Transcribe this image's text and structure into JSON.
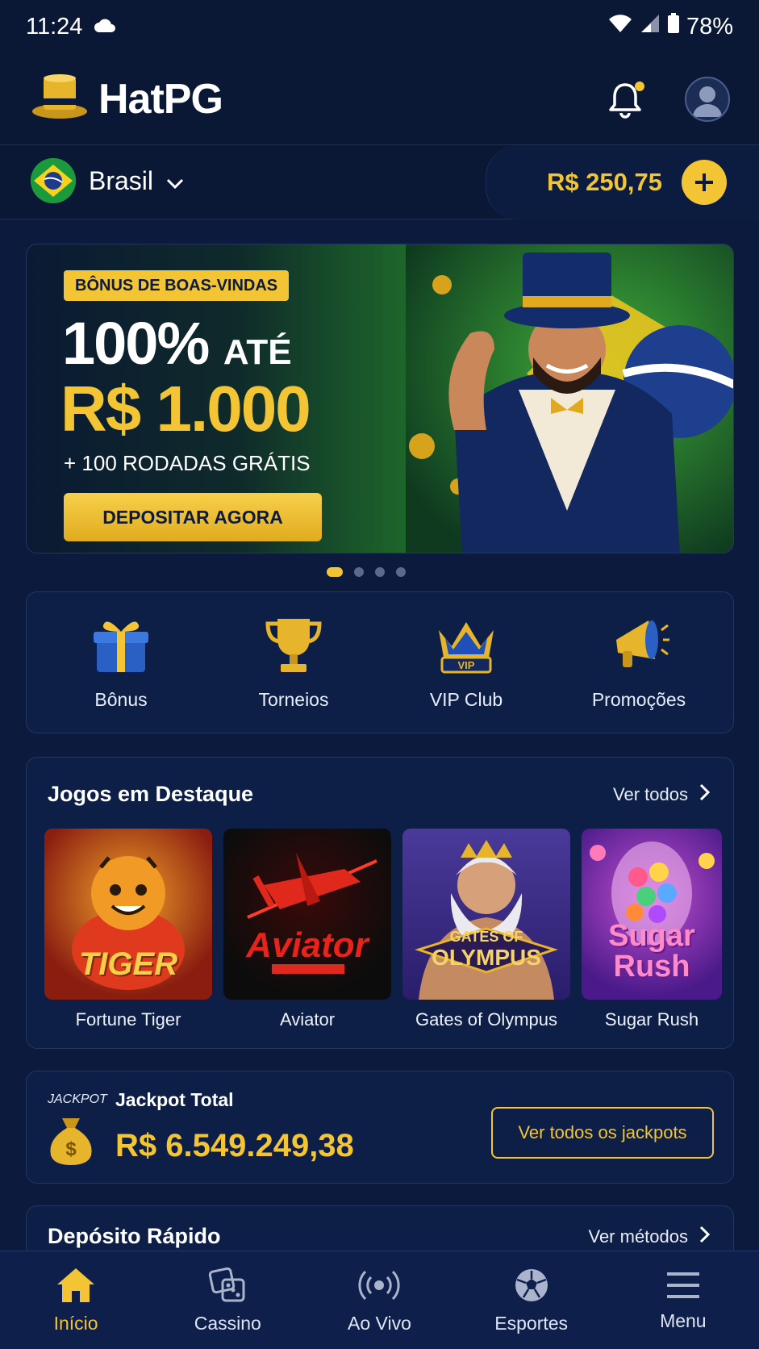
{
  "status_bar": {
    "time": "11:24",
    "battery": "78%"
  },
  "header": {
    "logo_hat": "Hat",
    "logo_pg": "PG"
  },
  "region": {
    "name": "Brasil"
  },
  "balance": {
    "amount": "R$ 250,75"
  },
  "banner": {
    "badge": "BÔNUS DE BOAS-VINDAS",
    "line1_main": "100%",
    "line1_suffix": "ATÉ",
    "line2": "R$ 1.000",
    "line3": "+ 100 RODADAS GRÁTIS",
    "cta": "DEPOSITAR AGORA"
  },
  "shortcuts": [
    {
      "label": "Bônus",
      "icon": "gift-icon"
    },
    {
      "label": "Torneios",
      "icon": "trophy-icon"
    },
    {
      "label": "VIP Club",
      "icon": "crown-icon"
    },
    {
      "label": "Promoções",
      "icon": "megaphone-icon"
    }
  ],
  "featured": {
    "title": "Jogos em Destaque",
    "see_all": "Ver todos",
    "games": [
      {
        "title": "Fortune Tiger",
        "thumb_text": "TIGER"
      },
      {
        "title": "Aviator",
        "thumb_text": "Aviator"
      },
      {
        "title": "Gates of Olympus",
        "thumb_text_1": "GATES OF",
        "thumb_text_2": "OLYMPUS"
      },
      {
        "title": "Sugar Rush",
        "thumb_text_1": "Sugar",
        "thumb_text_2": "Rush"
      }
    ]
  },
  "jackpot": {
    "brand": "JACKPOT",
    "label": "Jackpot Total",
    "amount": "R$ 6.549.249,38",
    "button": "Ver todos os jackpots"
  },
  "deposit": {
    "title": "Depósito Rápido",
    "see_all": "Ver métodos"
  },
  "bottom_nav": [
    {
      "label": "Início",
      "icon": "home-icon",
      "active": true
    },
    {
      "label": "Cassino",
      "icon": "dice-icon"
    },
    {
      "label": "Ao Vivo",
      "icon": "live-broadcast-icon"
    },
    {
      "label": "Esportes",
      "icon": "soccer-ball-icon"
    },
    {
      "label": "Menu",
      "icon": "hamburger-menu-icon"
    }
  ],
  "colors": {
    "background": "#0b1a3d",
    "accent_gold": "#f3c534",
    "card": "#0d1f47",
    "border": "#22375f"
  }
}
